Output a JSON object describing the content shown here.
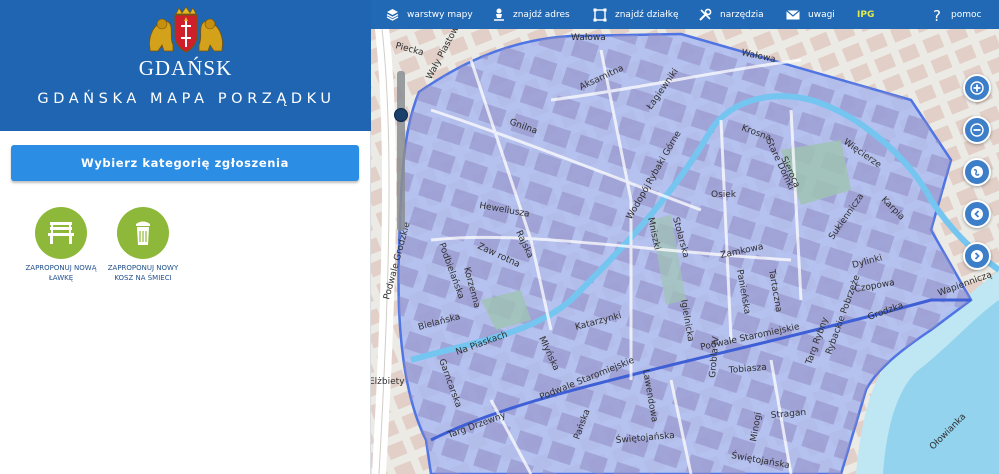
{
  "brand": {
    "city_name": "GDAŃSK",
    "app_title": "GDAŃSKA MAPA PORZĄDKU"
  },
  "panel": {
    "category_button_label": "Wybierz kategorię zgłoszenia",
    "actions": [
      {
        "label_line1": "ZAPROPONUJ NOWĄ",
        "label_line2": "ŁAWKĘ",
        "icon": "bench-icon"
      },
      {
        "label_line1": "ZAPROPONUJ NOWY",
        "label_line2": "KOSZ NA ŚMIECI",
        "icon": "trash-bin-icon"
      }
    ]
  },
  "toolbar": {
    "items": [
      {
        "label": "warstwy mapy",
        "icon": "layers-icon"
      },
      {
        "label": "znajdź adres",
        "icon": "person-pin-icon"
      },
      {
        "label": "znajdź działkę",
        "icon": "plot-frame-icon"
      },
      {
        "label": "narzędzia",
        "icon": "tools-icon"
      },
      {
        "label": "uwagi",
        "icon": "envelope-icon"
      },
      {
        "label": "IPG",
        "icon": ""
      },
      {
        "label": "pomoc",
        "icon": "question-icon"
      }
    ]
  },
  "map": {
    "tools": [
      "zoom-in-icon",
      "zoom-out-icon",
      "globe-icon",
      "chevron-left-icon",
      "chevron-right-icon"
    ],
    "zoom_level_fraction": 0.75,
    "streets": [
      "Wały Piastowskie",
      "Wałowa",
      "Aksamitna",
      "Łagiewniki",
      "Gnilna",
      "Krosna",
      "Stare Domki",
      "Sieroca",
      "Więcierze",
      "Rybaki Górne",
      "Wodopój",
      "Osiek",
      "Heweliusza",
      "Rajska",
      "Zaw rotna",
      "Podbielańska",
      "Korzenna",
      "Mniszki",
      "Stolarska",
      "Zamkowa",
      "Panieńska",
      "Tartaczna",
      "Sukiennicza",
      "Karpia",
      "Dylinki",
      "Czopowa",
      "Wapienniczą",
      "Grodzka",
      "Igielnicka",
      "Katarzynki",
      "Bielańska",
      "Na Piaskach",
      "Młyńska",
      "Podwale Staromiejskie",
      "Garncarska",
      "Tobiasza",
      "Grobla IV",
      "Targ Rybny",
      "Rybackie Pobrzeże",
      "Lawendowa",
      "Stragan",
      "Targ Drzewny",
      "Pańska",
      "Świętojańska",
      "Minogi",
      "Ołowianka",
      "Podwale Grodzkie",
      "Elżbiety",
      "Pieckа"
    ]
  },
  "colors": {
    "brand_blue": "#1f65b2",
    "button_blue": "#2b8de4",
    "action_green": "#8eb83a",
    "ipg_yellow": "#e3ea4d",
    "area_fill": "#a8b8f0",
    "area_border": "#4f74e3",
    "water": "#4fc3ef"
  }
}
